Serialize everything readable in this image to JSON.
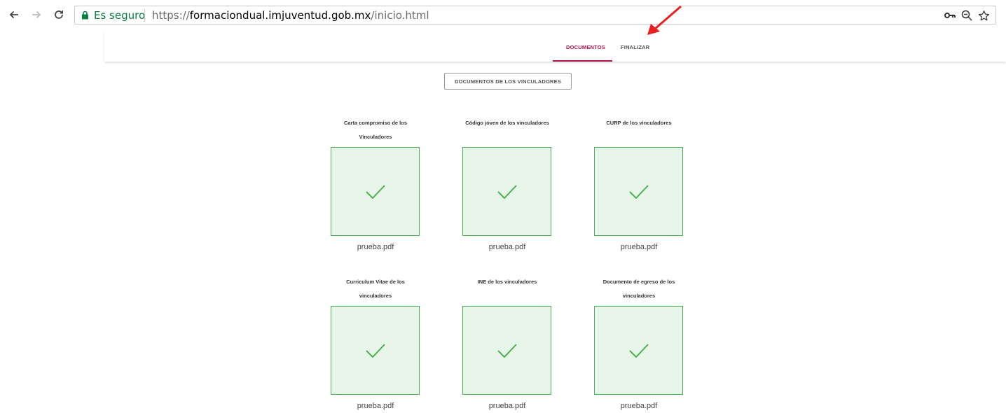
{
  "browser": {
    "secure_label": "Es seguro",
    "url_scheme": "https://",
    "url_domain": "formaciondual.imjuventud.gob.mx",
    "url_path": "/inicio.html"
  },
  "nav": {
    "tabs": [
      "DOCUMENTOS",
      "FINALIZAR"
    ],
    "active_tab": "DOCUMENTOS",
    "accent_color": "#b3124e"
  },
  "section_button_label": "DOCUMENTOS DE LOS VINCULADORES",
  "documents": [
    {
      "title_lines": [
        "Carta compromiso de los",
        "Vinculadores"
      ],
      "file": "prueba.pdf",
      "status": "check-icon"
    },
    {
      "title_lines": [
        "Código joven de los vinculadores"
      ],
      "file": "prueba.pdf",
      "status": "check-icon"
    },
    {
      "title_lines": [
        "CURP de los vinculadores"
      ],
      "file": "prueba.pdf",
      "status": "check-icon"
    },
    {
      "title_lines": [
        "Curriculum Vitae de los",
        "vinculadores"
      ],
      "file": "prueba.pdf",
      "status": "check-icon"
    },
    {
      "title_lines": [
        "INE de los vinculadores"
      ],
      "file": "prueba.pdf",
      "status": "check-icon"
    },
    {
      "title_lines": [
        "Documento de egreso de los",
        "vinculadores"
      ],
      "file": "prueba.pdf",
      "status": "check-icon"
    }
  ],
  "colors": {
    "success": "#4caf50",
    "success_bg": "#e8f5e9",
    "annotation_arrow": "#e8201f"
  }
}
